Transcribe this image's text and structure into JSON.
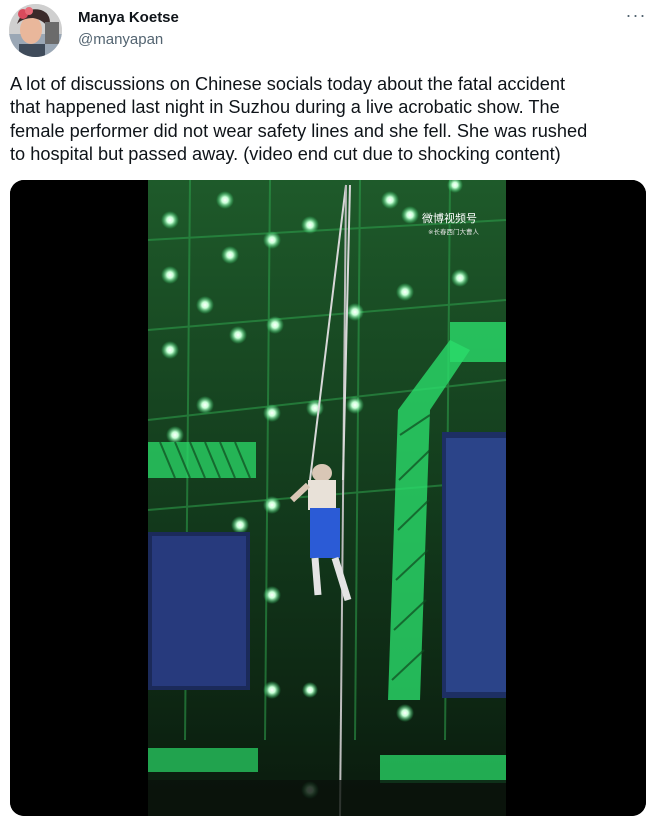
{
  "author": {
    "display_name": "Manya Koetse",
    "handle": "@manyapan"
  },
  "menu": {
    "more_label": "···"
  },
  "tweet": {
    "text": "A lot of discussions on Chinese socials today about the fatal accident\nthat happened last night in Suzhou during a live acrobatic show. The\nfemale performer did not wear safety lines and she fell. She was rushed\nto hospital but passed away. (video end cut due to shocking content)"
  },
  "media": {
    "watermark": "微博视频号",
    "watermark_sub": "※长春西门大曹人"
  },
  "colors": {
    "text": "#0f1419",
    "secondary": "#536471",
    "stage_green": "#2bdc6a"
  }
}
